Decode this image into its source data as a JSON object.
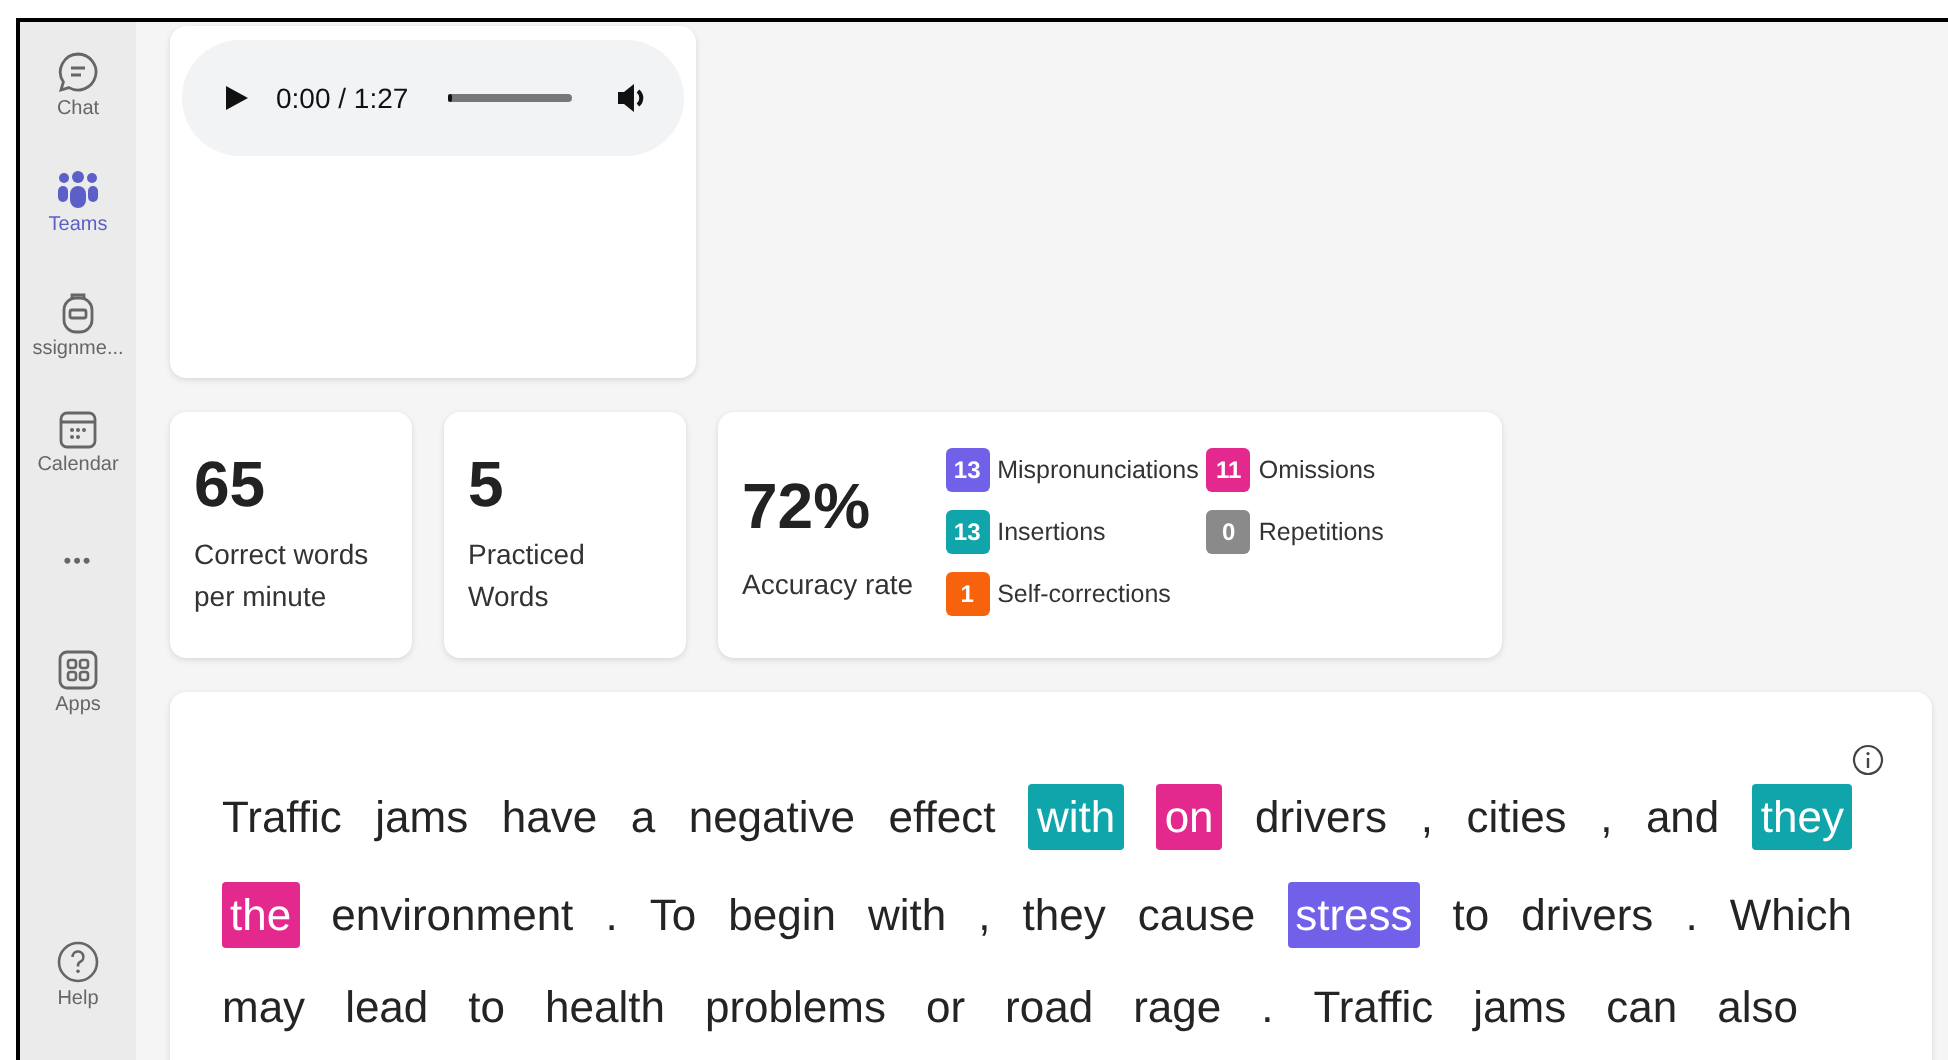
{
  "sidebar": {
    "items": [
      {
        "label": "Chat",
        "kind": "chat",
        "selected": false
      },
      {
        "label": "Teams",
        "kind": "teams",
        "selected": true
      },
      {
        "label": "ssignme...",
        "kind": "backpack",
        "selected": false
      },
      {
        "label": "Calendar",
        "kind": "calendar",
        "selected": false
      },
      {
        "label": "•••",
        "kind": "more",
        "selected": false
      },
      {
        "label": "Apps",
        "kind": "apps",
        "selected": false
      }
    ],
    "help": {
      "label": "Help"
    }
  },
  "audio": {
    "time": "0:00 / 1:27",
    "level": 0
  },
  "stats": [
    {
      "value": "65",
      "label": "Correct words per minute"
    },
    {
      "value": "5",
      "label": "Practiced Words"
    }
  ],
  "accuracy": {
    "value": "72%",
    "label": "Accuracy rate",
    "errors": [
      {
        "count": "13",
        "label": "Mispronunciations",
        "color": "#7160e8"
      },
      {
        "count": "11",
        "label": "Omissions",
        "color": "#e3298d"
      },
      {
        "count": "13",
        "label": "Insertions",
        "color": "#0fa5aa"
      },
      {
        "count": "0",
        "label": "Repetitions",
        "color": "#8a8a8a"
      },
      {
        "count": "1",
        "label": "Self-corrections",
        "color": "#f7630c"
      }
    ]
  },
  "passage": {
    "lines": [
      [
        {
          "text": "Traffic"
        },
        {
          "text": "jams"
        },
        {
          "text": "have"
        },
        {
          "text": "a"
        },
        {
          "text": "negative"
        },
        {
          "text": "effect"
        },
        {
          "text": "with",
          "color": "#0fa5aa"
        },
        {
          "text": "on",
          "color": "#e3298d"
        },
        {
          "text": "drivers"
        },
        {
          "text": ","
        },
        {
          "text": "cities"
        },
        {
          "text": ","
        },
        {
          "text": "and"
        },
        {
          "text": "they",
          "color": "#0fa5aa"
        }
      ],
      [
        {
          "text": "the",
          "color": "#e3298d"
        },
        {
          "text": "environment"
        },
        {
          "text": "."
        },
        {
          "text": "To"
        },
        {
          "text": "begin"
        },
        {
          "text": "with"
        },
        {
          "text": ","
        },
        {
          "text": "they"
        },
        {
          "text": "cause"
        },
        {
          "text": "stress",
          "color": "#7160e8"
        },
        {
          "text": "to"
        },
        {
          "text": "drivers"
        },
        {
          "text": "."
        },
        {
          "text": "Which"
        }
      ],
      [
        {
          "text": "may"
        },
        {
          "text": "lead"
        },
        {
          "text": "to"
        },
        {
          "text": "health"
        },
        {
          "text": "problems"
        },
        {
          "text": "or"
        },
        {
          "text": "road"
        },
        {
          "text": "rage"
        },
        {
          "text": "."
        },
        {
          "text": "Traffic"
        },
        {
          "text": "jams"
        },
        {
          "text": "can"
        },
        {
          "text": "also"
        }
      ]
    ]
  }
}
